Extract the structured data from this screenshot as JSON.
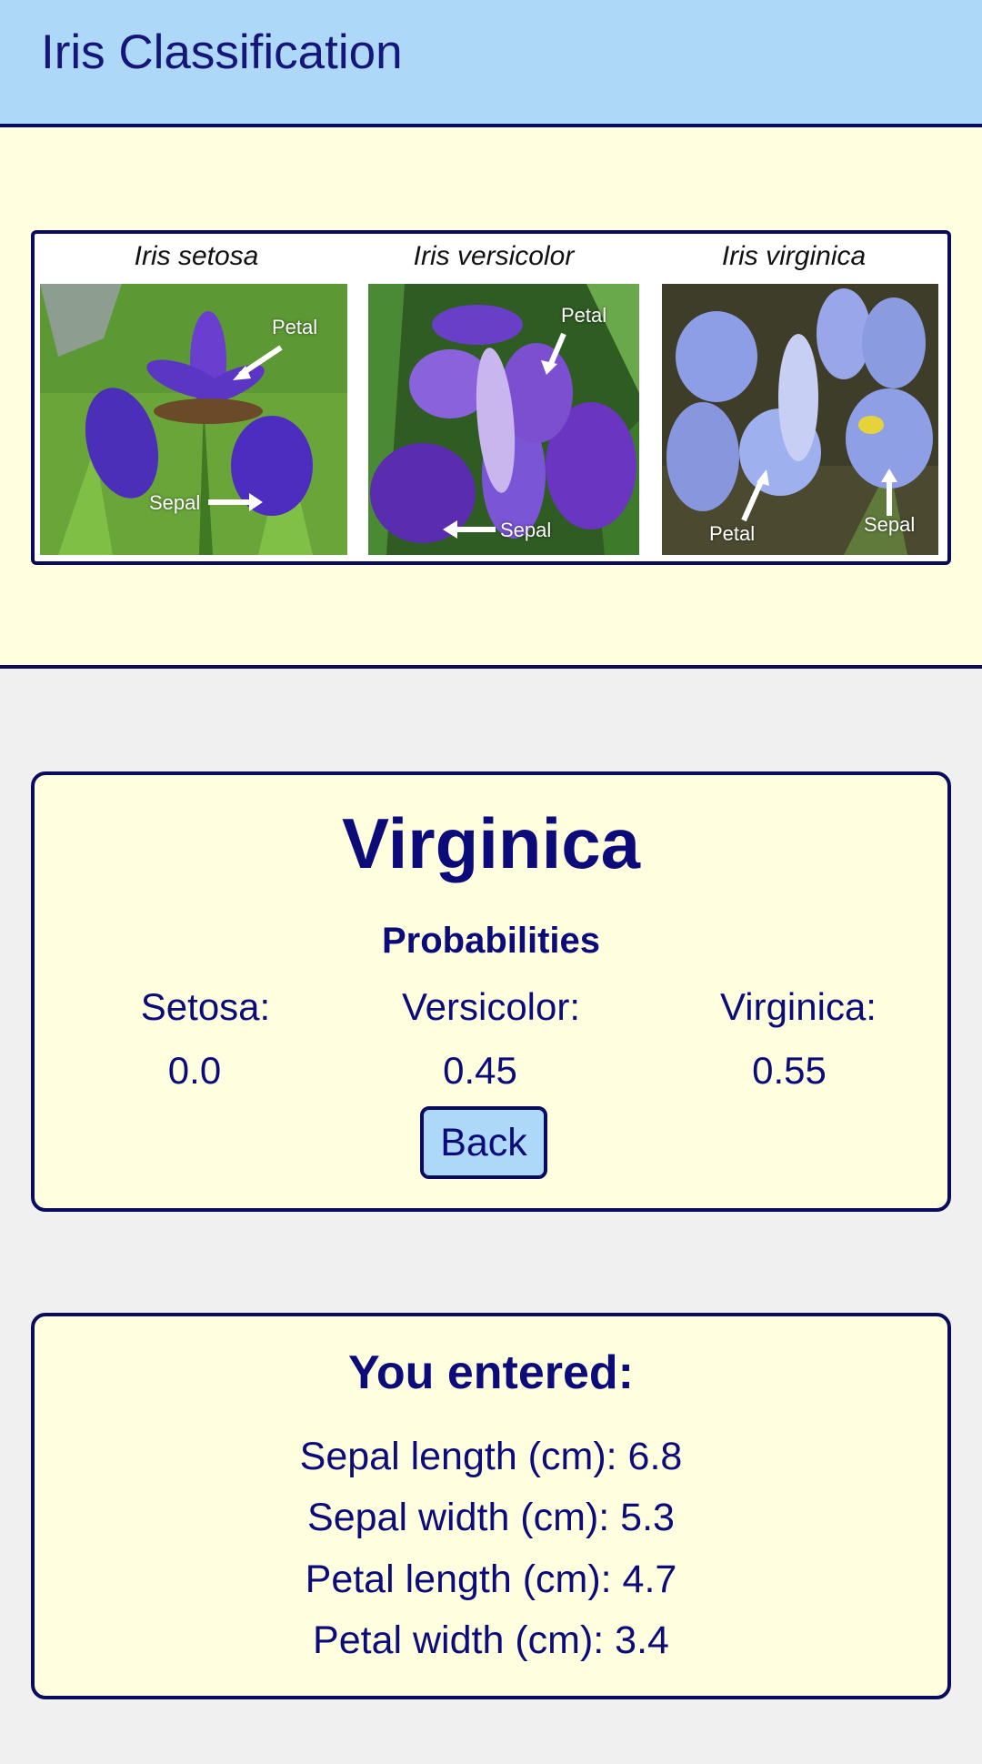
{
  "header": {
    "title": "Iris Classification"
  },
  "hero": {
    "species": [
      {
        "caption": "Iris setosa",
        "labels": [
          "Petal",
          "Sepal"
        ]
      },
      {
        "caption": "Iris versicolor",
        "labels": [
          "Petal",
          "Sepal"
        ]
      },
      {
        "caption": "Iris virginica",
        "labels": [
          "Petal",
          "Sepal"
        ]
      }
    ]
  },
  "result": {
    "prediction": "Virginica",
    "probabilities_heading": "Probabilities",
    "probabilities": [
      {
        "label": "Setosa:",
        "value": "0.0"
      },
      {
        "label": "Versicolor:",
        "value": "0.45"
      },
      {
        "label": "Virginica:",
        "value": "0.55"
      }
    ],
    "back_label": "Back"
  },
  "entered": {
    "heading": "You entered:",
    "lines": [
      "Sepal length (cm): 6.8",
      "Sepal width (cm): 5.3",
      "Petal length (cm): 4.7",
      "Petal width (cm): 3.4"
    ]
  },
  "colors": {
    "header_bg": "#add8f7",
    "panel_bg": "#fffede",
    "page_bg": "#f0f0f0",
    "border": "#0b0b5e",
    "text": "#0b0b7a"
  }
}
